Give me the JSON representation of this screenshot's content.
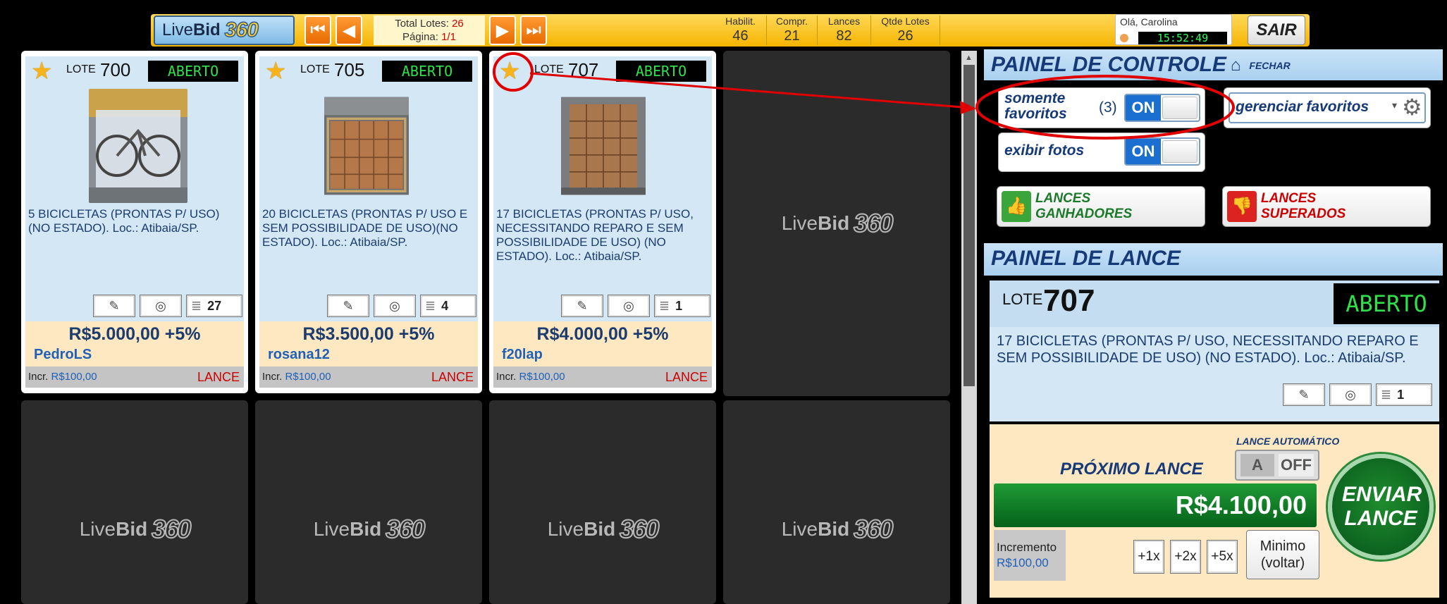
{
  "topbar": {
    "brand_live": "Live",
    "brand_bid": "Bid",
    "brand_360": "360",
    "nav": {
      "first_icon": "skip-first-icon",
      "prev_icon": "prev-icon",
      "next_icon": "next-icon",
      "last_icon": "skip-last-icon"
    },
    "total_lotes_label": "Total Lotes:",
    "total_lotes_value": "26",
    "pagina_label": "Página:",
    "pagina_value": "1/1",
    "stats": [
      {
        "label": "Habilit.",
        "value": "46"
      },
      {
        "label": "Compr.",
        "value": "21"
      },
      {
        "label": "Lances",
        "value": "82"
      },
      {
        "label": "Qtde Lotes",
        "value": "26"
      }
    ],
    "greeting": "Olá, Carolina",
    "clock": "15:52:49",
    "logout": "SAIR"
  },
  "cards": [
    {
      "lote_label": "LOTE",
      "lote_num": "700",
      "status": "ABERTO",
      "description": "5 BICICLETAS (PRONTAS P/ USO)(NO ESTADO). Loc.: Atibaia/SP.",
      "count": "27",
      "price": "R$5.000,00 +5%",
      "bidder": "PedroLS",
      "incr_label": "Incr.",
      "incr_value": "R$100,00",
      "lance": "LANCE"
    },
    {
      "lote_label": "LOTE",
      "lote_num": "705",
      "status": "ABERTO",
      "description": "20 BICICLETAS (PRONTAS P/ USO E SEM POSSIBILIDADE DE USO)(NO ESTADO). Loc.: Atibaia/SP.",
      "count": "4",
      "price": "R$3.500,00 +5%",
      "bidder": "rosana12",
      "incr_label": "Incr.",
      "incr_value": "R$100,00",
      "lance": "LANCE"
    },
    {
      "lote_label": "LOTE",
      "lote_num": "707",
      "status": "ABERTO",
      "description": "17 BICICLETAS (PRONTAS P/ USO, NECESSITANDO REPARO E SEM POSSIBILIDADE DE USO) (NO ESTADO). Loc.: Atibaia/SP.",
      "count": "1",
      "price": "R$4.000,00 +5%",
      "bidder": "f20lap",
      "incr_label": "Incr.",
      "incr_value": "R$100,00",
      "lance": "LANCE"
    }
  ],
  "watermark": {
    "live": "Live",
    "bid": "Bid",
    "n360": "360"
  },
  "painel_controle": {
    "title": "PAINEL DE CONTROLE",
    "fechar": "FECHAR",
    "somente_favoritos": "somente favoritos",
    "fav_count": "(3)",
    "toggle_on": "ON",
    "gerenciar": "gerenciar favoritos",
    "exibir_fotos": "exibir fotos",
    "lances_ganhadores": "LANCES GANHADORES",
    "lances_superados": "LANCES SUPERADOS"
  },
  "painel_lance": {
    "title": "PAINEL DE LANCE",
    "lote_label": "LOTE",
    "lote_num": "707",
    "status": "ABERTO",
    "description": "17 BICICLETAS (PRONTAS P/ USO, NECESSITANDO REPARO E SEM POSSIBILIDADE DE USO) (NO ESTADO). Loc.: Atibaia/SP.",
    "count": "1",
    "lance_automatico": "LANCE AUTOMÁTICO",
    "auto_a": "A",
    "auto_off": "OFF",
    "proximo_lance": "PRÓXIMO LANCE",
    "bid_value": "R$4.100,00",
    "enviar_lance": "ENVIAR LANCE",
    "incremento_label": "Incremento",
    "incremento_value": "R$100,00",
    "mult": [
      "+1x",
      "+2x",
      "+5x"
    ],
    "minimo_line1": "Minimo",
    "minimo_line2": "(voltar)"
  },
  "colors": {
    "accent_orange": "#f5b400",
    "status_green": "#2fe04a",
    "brand_blue": "#163a78",
    "annotation_red": "#e00000"
  }
}
